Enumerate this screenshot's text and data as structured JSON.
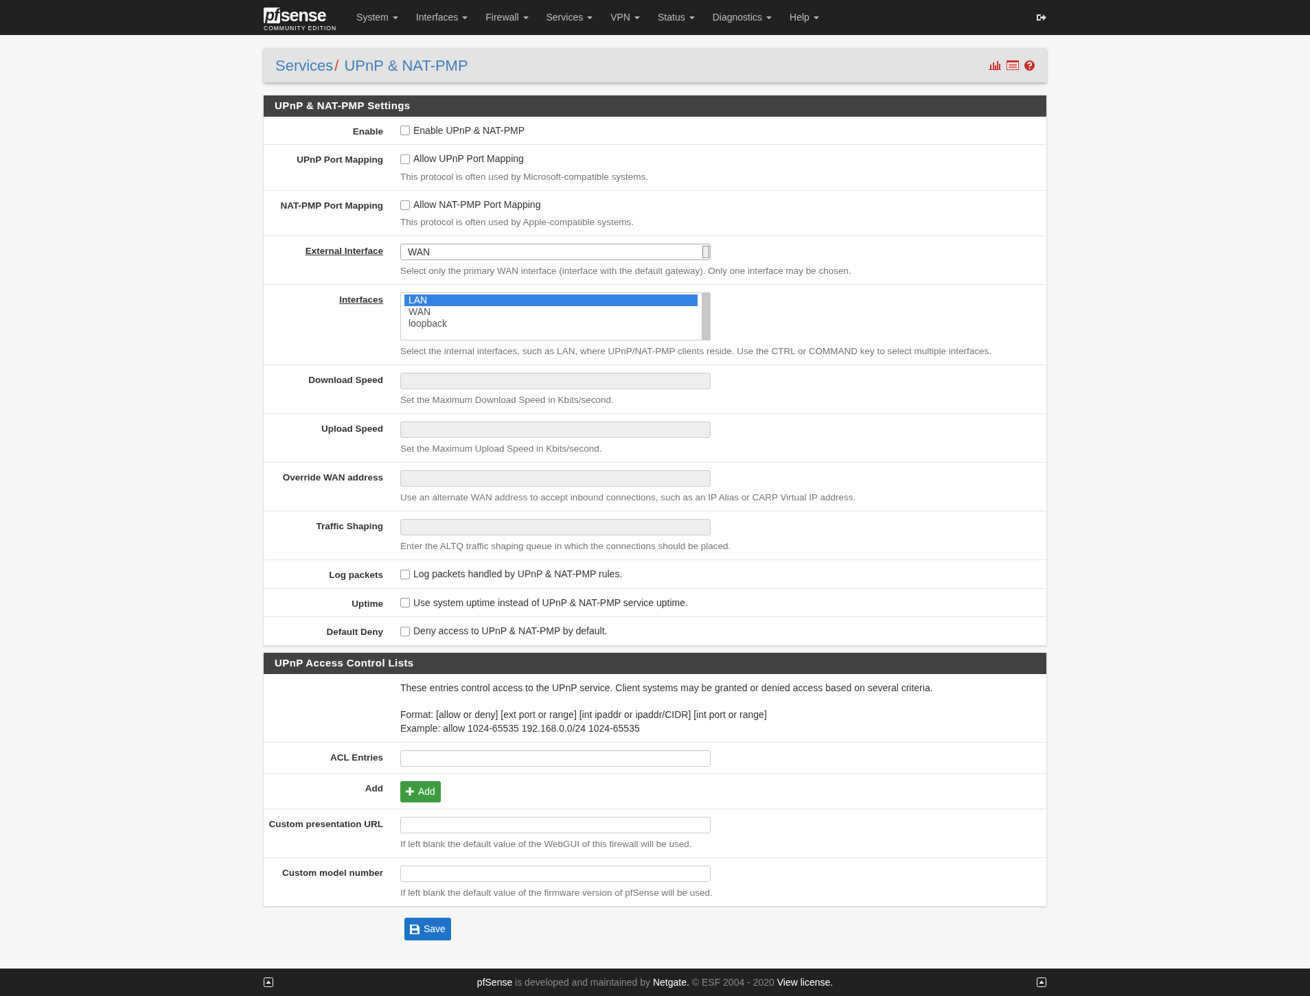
{
  "navbar": {
    "logo": {
      "mark": "pf",
      "word": "sense",
      "edition": "COMMUNITY EDITION"
    },
    "menus": [
      "System",
      "Interfaces",
      "Firewall",
      "Services",
      "VPN",
      "Status",
      "Diagnostics",
      "Help"
    ]
  },
  "breadcrumb": [
    {
      "text": "Services",
      "separator": "/"
    },
    {
      "text": "UPnP & NAT-PMP"
    }
  ],
  "sections": [
    {
      "title": "UPnP & NAT-PMP Settings",
      "rows": [
        {
          "kind": "checkbox",
          "label": "Enable",
          "checked": false,
          "text": "Enable UPnP & NAT-PMP"
        },
        {
          "kind": "checkbox",
          "label": "UPnP Port Mapping",
          "checked": false,
          "text": "Allow UPnP Port Mapping",
          "help": "This protocol is often used by Microsoft-compatible systems."
        },
        {
          "kind": "checkbox",
          "label": "NAT-PMP Port Mapping",
          "checked": false,
          "text": "Allow NAT-PMP Port Mapping",
          "help": "This protocol is often used by Apple-compatible systems."
        },
        {
          "kind": "select",
          "label": "External Interface",
          "underlined": true,
          "value": "WAN",
          "help": "Select only the primary WAN interface (interface with the default gateway). Only one interface may be chosen."
        },
        {
          "kind": "listbox",
          "label": "Interfaces",
          "underlined": true,
          "options": [
            {
              "label": "LAN",
              "selected": true
            },
            {
              "label": "WAN",
              "selected": false
            },
            {
              "label": "loopback",
              "selected": false
            }
          ],
          "help": "Select the internal interfaces, such as LAN, where UPnP/NAT-PMP clients reside. Use the CTRL or COMMAND key to select multiple interfaces."
        },
        {
          "kind": "text",
          "label": "Download Speed",
          "disabled": true,
          "help": "Set the Maximum Download Speed in Kbits/second."
        },
        {
          "kind": "text",
          "label": "Upload Speed",
          "disabled": true,
          "help": "Set the Maximum Upload Speed in Kbits/second."
        },
        {
          "kind": "text",
          "label": "Override WAN address",
          "disabled": true,
          "help": "Use an alternate WAN address to accept inbound connections, such as an IP Alias or CARP Virtual IP address."
        },
        {
          "kind": "text",
          "label": "Traffic Shaping",
          "disabled": true,
          "help": "Enter the ALTQ traffic shaping queue in which the connections should be placed."
        },
        {
          "kind": "checkbox",
          "label": "Log packets",
          "checked": false,
          "text": "Log packets handled by UPnP & NAT-PMP rules."
        },
        {
          "kind": "checkbox",
          "label": "Uptime",
          "checked": false,
          "text": "Use system uptime instead of UPnP & NAT-PMP service uptime."
        },
        {
          "kind": "checkbox",
          "label": "Default Deny",
          "checked": false,
          "text": "Deny access to UPnP & NAT-PMP by default."
        }
      ]
    },
    {
      "title": "UPnP Access Control Lists",
      "rows": [
        {
          "kind": "info",
          "paragraphs": [
            [
              "These entries control access to the UPnP service. Client systems may be granted or denied access based on several criteria."
            ],
            [
              "Format: [allow or deny] [ext port or range] [int ipaddr or ipaddr/CIDR] [int port or range]",
              "Example: allow 1024-65535 192.168.0.0/24 1024-65535"
            ]
          ]
        },
        {
          "kind": "text",
          "label": "ACL Entries",
          "disabled": false
        },
        {
          "kind": "button",
          "label": "Add",
          "button": "Add"
        },
        {
          "kind": "text",
          "label": "Custom presentation URL",
          "disabled": false,
          "help": "If left blank the default value of the WebGUI of this firewall will be used."
        },
        {
          "kind": "text",
          "label": "Custom model number",
          "disabled": false,
          "help": "If left blank the default value of the firmware version of pfSense will be used."
        }
      ]
    }
  ],
  "save_button": "Save",
  "footer": [
    {
      "text": "pfSense",
      "link": true
    },
    {
      "text": " is developed and maintained by ",
      "link": false
    },
    {
      "text": "Netgate.",
      "link": true
    },
    {
      "text": " © ESF 2004 - 2020 ",
      "link": false
    },
    {
      "text": "View license.",
      "link": true
    }
  ]
}
